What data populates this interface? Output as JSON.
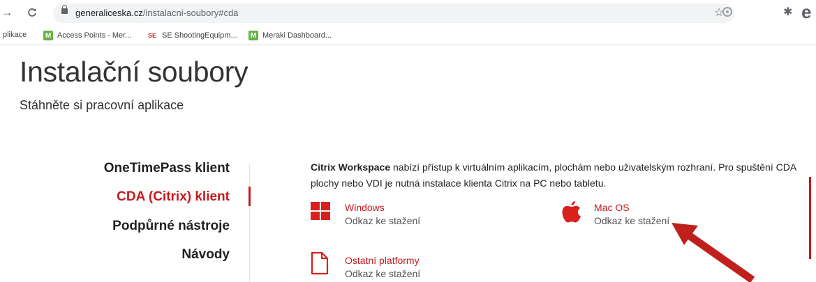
{
  "browser": {
    "url_host": "generaliceska.cz",
    "url_path": "/instalacni-soubory#cda",
    "bookmarks": [
      {
        "label": "plikace",
        "icon": "apps-icon"
      },
      {
        "label": "Access Points - Mer...",
        "icon": "meraki-icon"
      },
      {
        "label": "SE ShootingEquipm...",
        "icon": "se-icon"
      },
      {
        "label": "Meraki Dashboard...",
        "icon": "meraki-icon"
      }
    ]
  },
  "page": {
    "title": "Instalační soubory",
    "subtitle": "Stáhněte si pracovní aplikace"
  },
  "sidebar": {
    "items": [
      {
        "label": "OneTimePass klient",
        "active": false
      },
      {
        "label": "CDA (Citrix) klient",
        "active": true
      },
      {
        "label": "Podpůrné nástroje",
        "active": false
      },
      {
        "label": "Návody",
        "active": false
      }
    ]
  },
  "content": {
    "desc_bold": "Citrix Workspace",
    "desc_rest": " nabízí přístup k virtuálním aplikacím, plochám nebo uživatelským rozhraní. Pro spuštění CDA plochy nebo VDI je nutná instalace klienta Citrix na PC nebo tabletu.",
    "downloads": [
      {
        "title": "Windows",
        "link": "Odkaz ke stažení",
        "icon": "windows-icon"
      },
      {
        "title": "Mac OS",
        "link": "Odkaz ke stažení",
        "icon": "apple-icon"
      },
      {
        "title": "Ostatní platformy",
        "link": "Odkaz ke stažení",
        "icon": "file-icon"
      }
    ]
  },
  "colors": {
    "accent": "#c6191e",
    "text": "#222222"
  }
}
